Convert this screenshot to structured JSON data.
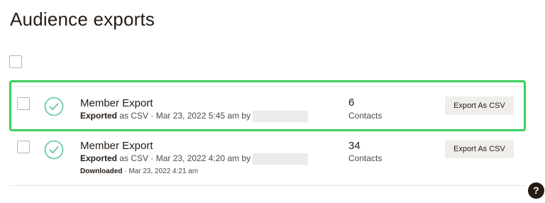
{
  "page": {
    "title": "Audience exports"
  },
  "colors": {
    "highlight": "#3ecf5d",
    "success_icon": "#5ec4a8",
    "button_bg": "#efeeea",
    "text": "#241c15"
  },
  "exports": [
    {
      "name": "Member Export",
      "status_label": "Exported",
      "format_text": " as CSV · Mar 23, 2022 5:45 am by",
      "count": "6",
      "count_label": "Contacts",
      "button_label": "Export As CSV",
      "icon": "check-circle-icon"
    },
    {
      "name": "Member Export",
      "status_label": "Exported",
      "format_text": " as CSV · Mar 23, 2022 4:20 am by",
      "downloaded_label": "Downloaded",
      "downloaded_text": " · Mar 23, 2022 4:21 am",
      "count": "34",
      "count_label": "Contacts",
      "button_label": "Export As CSV",
      "icon": "check-circle-icon"
    }
  ],
  "help": {
    "label": "?"
  }
}
